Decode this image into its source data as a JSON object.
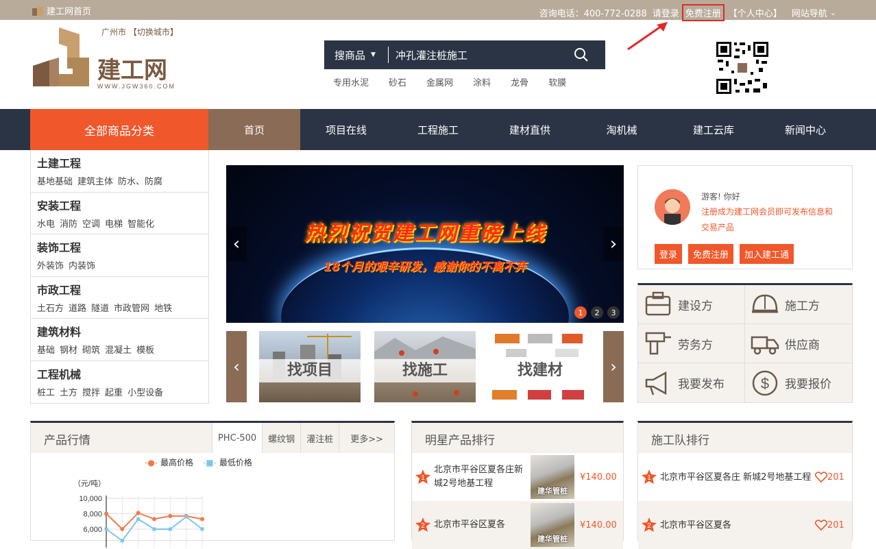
{
  "topbar": {
    "home": "建工网首页",
    "phone": "咨询电话：400-772-0288",
    "login": "请登录",
    "register": "免费注册",
    "personal": "【个人中心】",
    "sitenav": "网站导航",
    "sitenav_caret": "⌄"
  },
  "header": {
    "city": "广州市",
    "switch_city": "【切换城市】",
    "logo_text": "建工网",
    "logo_url": "WWW.JGW360.COM",
    "search": {
      "category": "搜商品",
      "caret": "▼",
      "query": "冲孔灌注桩施工"
    },
    "hot": [
      "专用水泥",
      "砂石",
      "金属网",
      "涂料",
      "龙骨",
      "软膜"
    ]
  },
  "nav": {
    "all": "全部商品分类",
    "items": [
      "首页",
      "项目在线",
      "工程施工",
      "建材直供",
      "淘机械",
      "建工云库",
      "新闻中心"
    ]
  },
  "sidebar": [
    {
      "title": "土建工程",
      "subs": [
        "基地基础",
        "建筑主体",
        "防水、防腐"
      ]
    },
    {
      "title": "安装工程",
      "subs": [
        "水电",
        "消防",
        "空调",
        "电梯",
        "智能化"
      ]
    },
    {
      "title": "装饰工程",
      "subs": [
        "外装饰",
        "内装饰"
      ]
    },
    {
      "title": "市政工程",
      "subs": [
        "土石方",
        "道路",
        "隧道",
        "市政管网",
        "地铁"
      ]
    },
    {
      "title": "建筑材料",
      "subs": [
        "基础",
        "钢材",
        "砌筑",
        "混凝土",
        "模板"
      ]
    },
    {
      "title": "工程机械",
      "subs": [
        "桩工",
        "土方",
        "搅拌",
        "起重",
        "小型设备"
      ]
    }
  ],
  "banner": {
    "title": "热烈祝贺建工网重磅上线",
    "subtitle": "18个月的艰辛研发，感谢你的不离不弃",
    "prev": "‹",
    "next": "›",
    "dots": [
      "1",
      "2",
      "3"
    ],
    "active_dot": 1
  },
  "thumbs": {
    "prev": "‹",
    "next": "›",
    "items": [
      "找项目",
      "找施工",
      "找建材"
    ]
  },
  "user": {
    "greeting": "游客! 你好",
    "desc": "注册成为建工网会员即可发布信息和交易产品",
    "buttons": [
      "登录",
      "免费注册",
      "加入建工通"
    ]
  },
  "roles": [
    "建设方",
    "施工方",
    "劳务方",
    "供应商",
    "我要发布",
    "我要报价"
  ],
  "market": {
    "title": "产品行情",
    "tabs": [
      "PHC-500",
      "螺纹钢",
      "灌注桩",
      "更多>>"
    ]
  },
  "chart_data": {
    "type": "line",
    "ylabel": "（元/吨）",
    "y_ticks": [
      "10,000",
      "8,000",
      "6,000"
    ],
    "series": [
      {
        "name": "最高价格",
        "color": "#f07a4a",
        "values": [
          8000,
          6000,
          8100,
          7300,
          7700,
          7700,
          7300
        ]
      },
      {
        "name": "最低价格",
        "color": "#7ec4ee",
        "values": [
          6000,
          4500,
          7300,
          6000,
          6000,
          7600,
          6000
        ]
      }
    ]
  },
  "stars": {
    "title": "明星产品排行",
    "items": [
      {
        "rank": "1",
        "name": "北京市平谷区夏各庄新城2号地基工程",
        "img_label": "建华管桩",
        "price": "¥140.00"
      },
      {
        "rank": "2",
        "name": "北京市平谷区夏各",
        "img_label": "建华管桩",
        "price": "¥140.00"
      }
    ]
  },
  "teams": {
    "title": "施工队排行",
    "items": [
      {
        "rank": "1",
        "name": "北京市平谷区夏各庄 新城2号地基工程",
        "likes": "201"
      },
      {
        "rank": "2",
        "name": "北京市平谷区夏各",
        "likes": "201"
      }
    ]
  },
  "colors": {
    "accent": "#f0572a",
    "nav_bg": "#2b3444",
    "brown": "#8a6b55",
    "topbar": "#b8ab9a"
  }
}
